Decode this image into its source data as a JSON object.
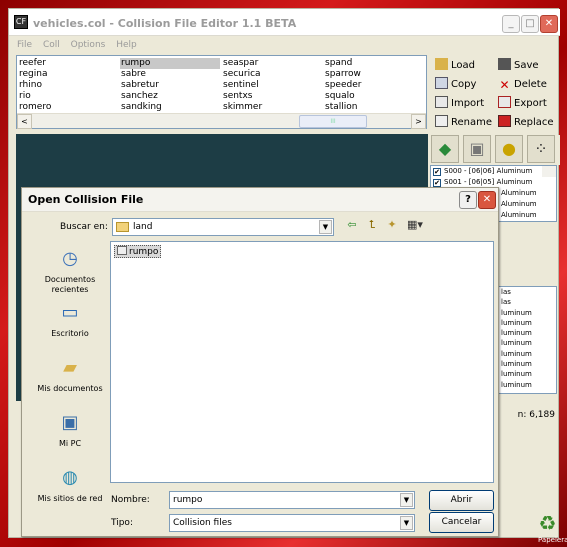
{
  "main_window": {
    "title": "vehicles.col - Collision File Editor 1.1 BETA",
    "app_icon": "CF",
    "caption_buttons": {
      "minimize": "_",
      "maximize": "□",
      "close": "✕"
    },
    "menu": [
      "File",
      "Coll",
      "Options",
      "Help"
    ],
    "vehicle_list": {
      "columns": [
        [
          "reefer",
          "regina",
          "rhino",
          "rio",
          "romero"
        ],
        [
          "rumpo",
          "sabre",
          "sabretur",
          "sanchez",
          "sandking"
        ],
        [
          "seaspar",
          "securica",
          "sentinel",
          "sentxs",
          "skimmer"
        ],
        [
          "spand",
          "sparrow",
          "speeder",
          "squalo",
          "stallion"
        ]
      ],
      "selected": "rumpo",
      "scroll_left": "<",
      "scroll_right": ">",
      "scroll_thumb": "III"
    },
    "actions": {
      "load": "Load",
      "save": "Save",
      "copy": "Copy",
      "delete": "Delete",
      "import": "Import",
      "export": "Export",
      "rename": "Rename",
      "replace": "Replace"
    },
    "material_list": [
      {
        "check": "✔",
        "text": "S000 - [06|06] Aluminum"
      },
      {
        "check": "✔",
        "text": "S001 - [06|05] Aluminum"
      },
      {
        "check": "",
        "text": "Aluminum"
      },
      {
        "check": "",
        "text": "Aluminum"
      },
      {
        "check": "",
        "text": "Aluminum"
      }
    ],
    "faces_list": [
      "las",
      "las",
      "luminum",
      "luminum",
      "luminum",
      "luminum",
      "luminum",
      "luminum",
      "luminum",
      "luminum"
    ],
    "status_text": "n: 6,189"
  },
  "dialog": {
    "title": "Open Collision File",
    "help_button": "?",
    "close_button": "✕",
    "lookin_label": "Buscar en:",
    "lookin_value": "land",
    "places": [
      {
        "label": "Documentos recientes"
      },
      {
        "label": "Escritorio"
      },
      {
        "label": "Mis documentos"
      },
      {
        "label": "Mi PC"
      },
      {
        "label": "Mis sitios de red"
      }
    ],
    "files": [
      "rumpo"
    ],
    "filename_label": "Nombre:",
    "filename_value": "rumpo",
    "filetype_label": "Tipo:",
    "filetype_value": "Collision files",
    "open_button": "Abrir",
    "cancel_button": "Cancelar"
  },
  "desktop": {
    "recycle_bin_label": "Papelera"
  }
}
